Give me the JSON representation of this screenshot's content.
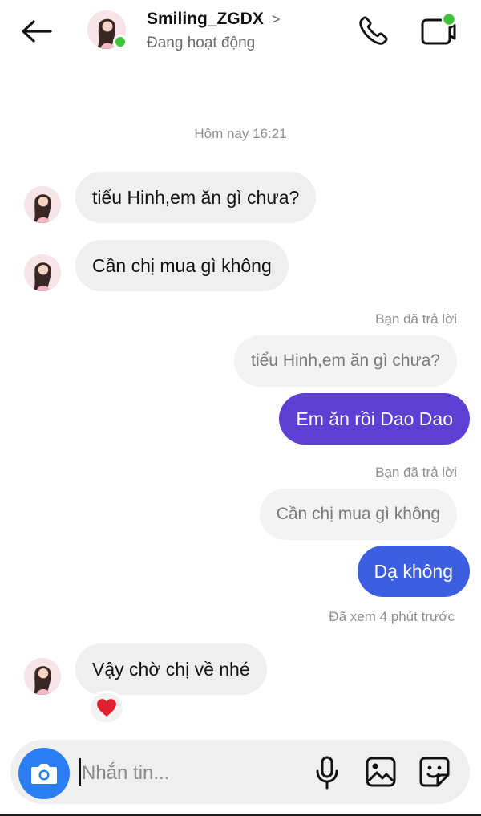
{
  "header": {
    "contact_name": "Smiling_ZGDX",
    "chevron": ">",
    "status": "Đang hoạt động"
  },
  "conversation": {
    "timestamp": "Hôm nay 16:21",
    "messages": [
      {
        "text": "tiểu Hinh,em ăn gì chưa?"
      },
      {
        "text": "Cần chị mua gì không"
      },
      {
        "reply_note": "Bạn đã trả lời",
        "quoted": "tiểu Hinh,em ăn gì chưa?",
        "text": "Em ăn rồi Dao Dao"
      },
      {
        "reply_note": "Bạn đã trả lời",
        "quoted": "Cần chị mua gì không",
        "text": "Dạ không"
      },
      {
        "text": "Vậy chờ chị về nhé",
        "reaction": "❤"
      }
    ],
    "seen": "Đã xem 4 phút trước"
  },
  "composer": {
    "placeholder": "Nhắn tin..."
  },
  "colors": {
    "accent_purple": "#5d3fd3",
    "accent_blue": "#3b5fe0",
    "online": "#3ec33a",
    "camera": "#2a7df2"
  },
  "icons": [
    "back-arrow-icon",
    "phone-icon",
    "video-call-icon",
    "camera-icon",
    "microphone-icon",
    "gallery-icon",
    "sticker-icon",
    "heart-icon"
  ]
}
